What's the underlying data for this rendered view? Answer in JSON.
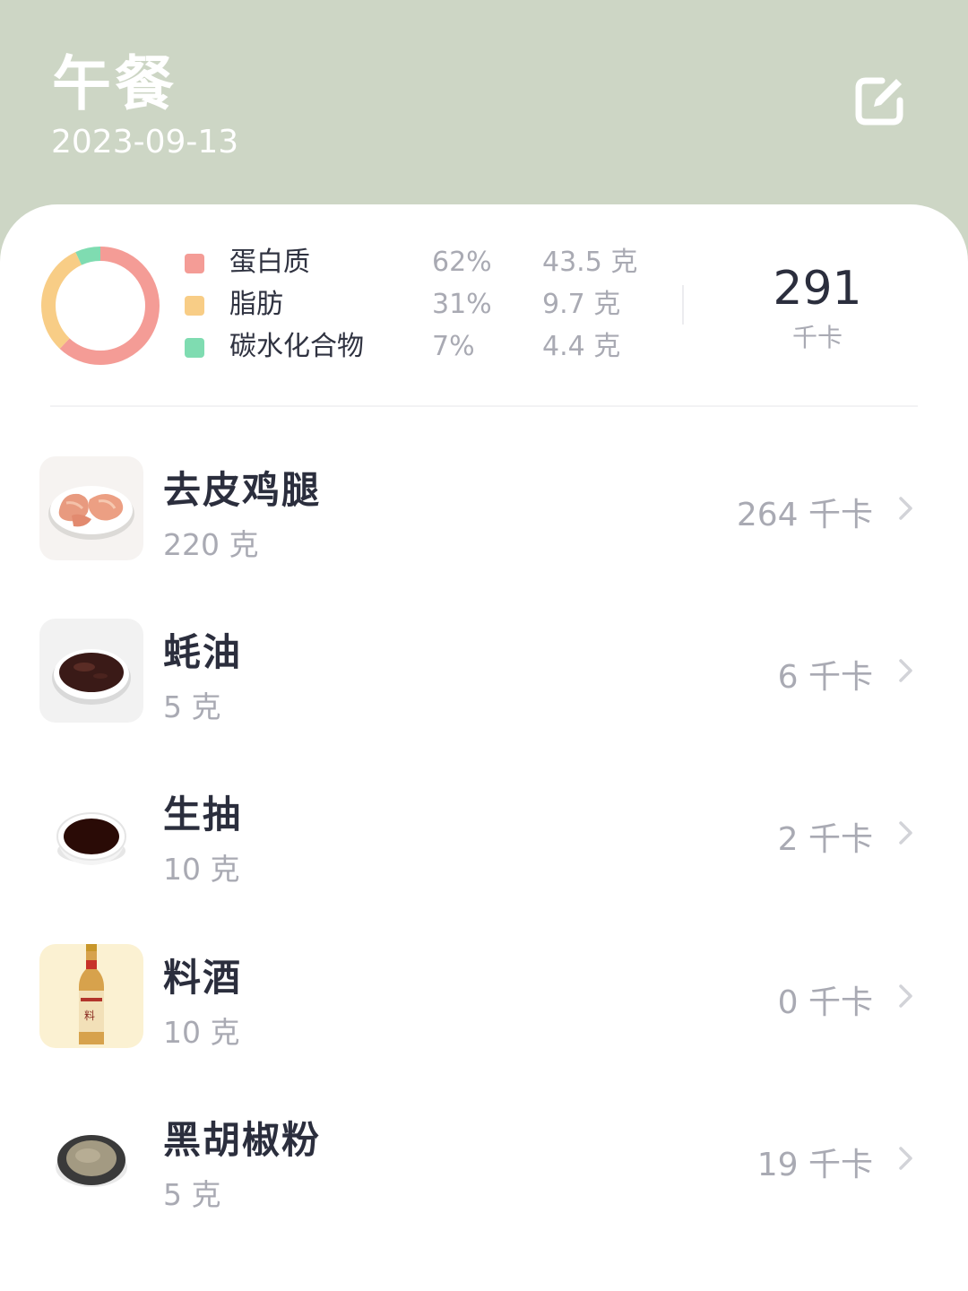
{
  "header": {
    "title": "午餐",
    "date": "2023-09-13",
    "edit_icon": "edit-icon"
  },
  "summary": {
    "macros": [
      {
        "name": "蛋白质",
        "percent": "62%",
        "amount": "43.5 克",
        "color": "#f49c96",
        "share": 0.62
      },
      {
        "name": "脂肪",
        "percent": "31%",
        "amount": "9.7 克",
        "color": "#f8cd86",
        "share": 0.31
      },
      {
        "name": "碳水化合物",
        "percent": "7%",
        "amount": "4.4 克",
        "color": "#7fdcb1",
        "share": 0.07
      }
    ],
    "total_kcal": "291",
    "total_unit": "千卡"
  },
  "foods": [
    {
      "name": "去皮鸡腿",
      "qty": "220 克",
      "kcal": "264 千卡",
      "image": "chicken-thigh-image"
    },
    {
      "name": "蚝油",
      "qty": "5 克",
      "kcal": "6 千卡",
      "image": "oyster-sauce-image"
    },
    {
      "name": "生抽",
      "qty": "10 克",
      "kcal": "2 千卡",
      "image": "soy-sauce-image"
    },
    {
      "name": "料酒",
      "qty": "10 克",
      "kcal": "0 千卡",
      "image": "cooking-wine-image"
    },
    {
      "name": "黑胡椒粉",
      "qty": "5 克",
      "kcal": "19 千卡",
      "image": "black-pepper-image"
    }
  ]
}
